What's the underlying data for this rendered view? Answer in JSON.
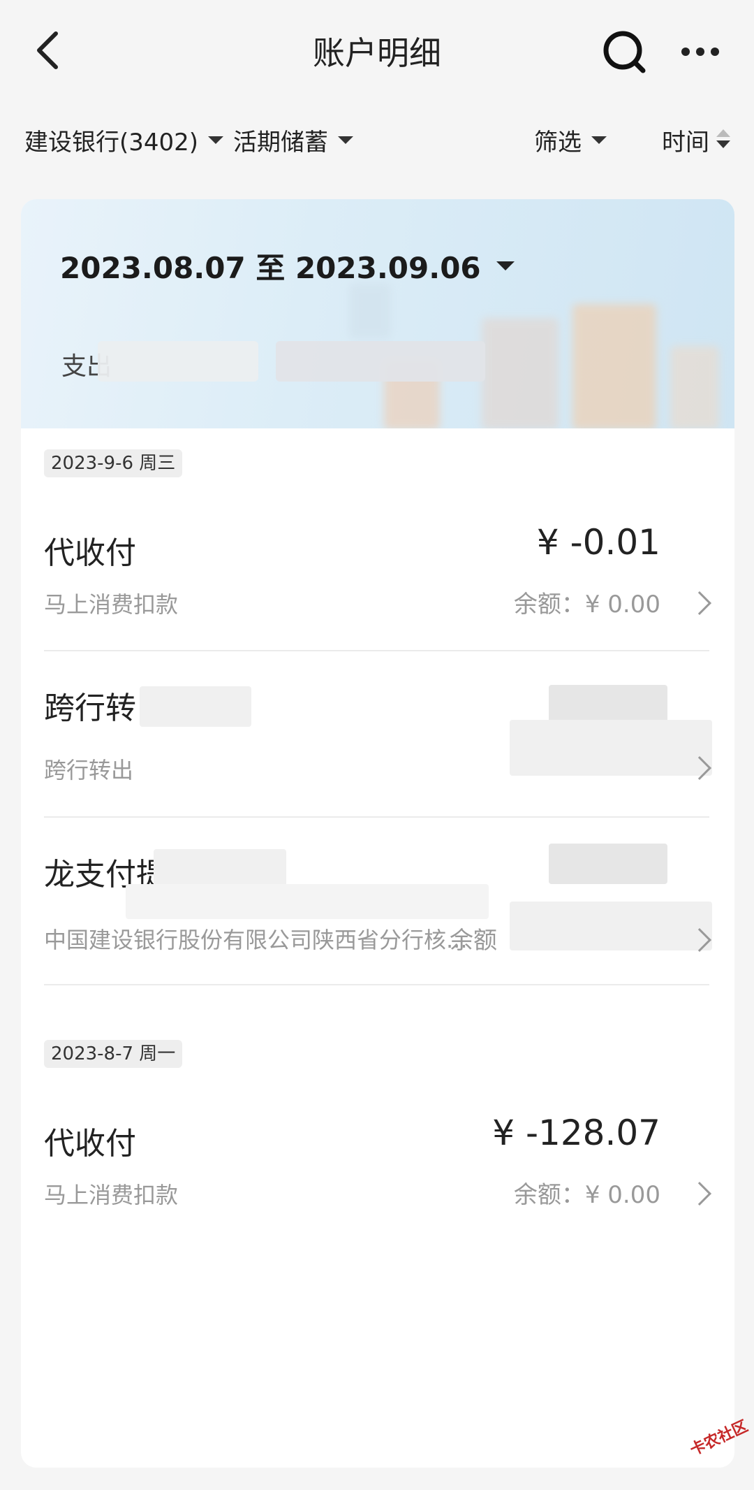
{
  "header": {
    "title": "账户明细",
    "icons": {
      "back": "back-arrow-icon",
      "search": "search-icon",
      "more": "more-dots-icon"
    }
  },
  "filters": {
    "account": "建设银行(3402)",
    "type": "活期储蓄",
    "filter": "筛选",
    "sort": "时间"
  },
  "summary": {
    "date_range": "2023.08.07 至 2023.09.06",
    "expense_label": "支出"
  },
  "groups": [
    {
      "date": "2023-9-6 周三",
      "transactions": [
        {
          "title": "代收付",
          "desc": "马上消费扣款",
          "amount": "¥ -0.01",
          "balance": "余额：¥ 0.00"
        },
        {
          "title": "跨行转",
          "desc": "跨行转出",
          "amount": "",
          "balance": ""
        },
        {
          "title": "龙支付提",
          "desc": "中国建设银行股份有限公司陕西省分行核...",
          "amount": "",
          "balance": "余额"
        }
      ]
    },
    {
      "date": "2023-8-7 周一",
      "transactions": [
        {
          "title": "代收付",
          "desc": "马上消费扣款",
          "amount": "¥ -128.07",
          "balance": "余额：¥ 0.00"
        }
      ]
    }
  ],
  "watermark": "卡农社区",
  "colors": {
    "background": "#f5f5f5",
    "card": "#ffffff",
    "banner": "#dcedf7",
    "muted_text": "#999999"
  }
}
